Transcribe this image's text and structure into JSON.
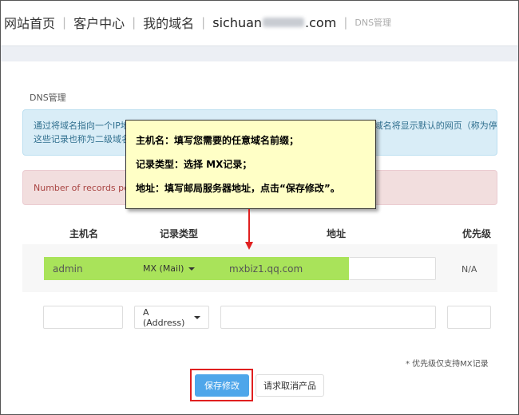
{
  "breadcrumb": {
    "home": "网站首页",
    "customer_center": "客户中心",
    "my_domains": "我的域名",
    "domain_prefix": "sichuan",
    "domain_suffix": ".com",
    "current": "DNS管理",
    "separator": "|"
  },
  "section_title": "DNS管理",
  "info_box": {
    "line1": "通过将域名指向一个IP地址，访问您的域名时将会显示此IP地址对应的网站，未作指向的域名将显示默认的网页（称为停泊）等等。",
    "line2": "这些记录也称为二级域名或子域名的解析记录。"
  },
  "alert": "Number of records per domain: 100",
  "table": {
    "headers": [
      "主机名",
      "记录类型",
      "地址",
      "优先级"
    ],
    "row1": {
      "host": "admin",
      "type": "MX (Mail)",
      "address": "mxbiz1.qq.com",
      "priority": "N/A"
    },
    "row2": {
      "host": "",
      "type": "A (Address)",
      "address": "",
      "priority": ""
    }
  },
  "note": "* 优先级仅支持MX记录",
  "buttons": {
    "save": "保存修改",
    "cancel": "请求取消产品"
  },
  "tooltip": {
    "line1": "主机名：填写您需要的任意域名前缀；",
    "line2": "记录类型：选择 MX记录；",
    "line3": "地址：填写邮局服务器地址，点击“保存修改”。"
  },
  "colors": {
    "highlight": "#a9e35a",
    "save_button": "#4ea6ea",
    "annotation_red": "#e02020",
    "tooltip_bg": "#ffffc6"
  }
}
